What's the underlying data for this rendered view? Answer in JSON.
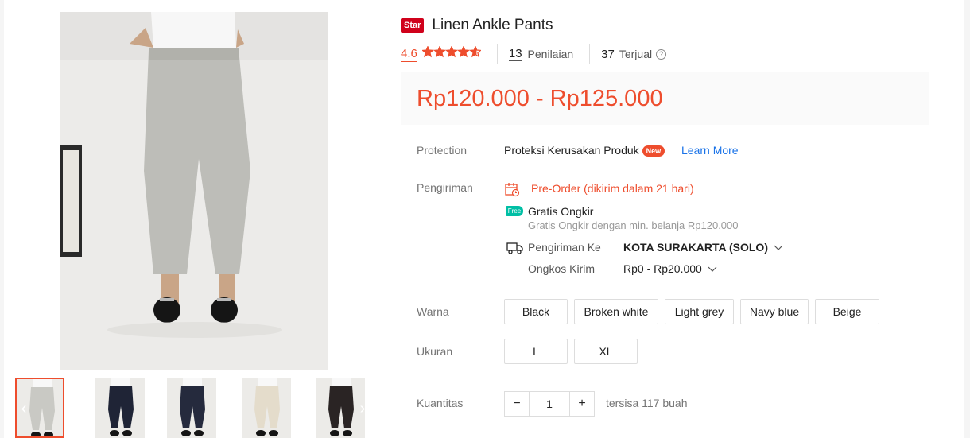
{
  "product": {
    "badge": "Star",
    "title": "Linen Ankle Pants",
    "rating": "4.6",
    "review_count": "13",
    "review_label": "Penilaian",
    "sold_count": "37",
    "sold_label": "Terjual",
    "price": "Rp120.000 - Rp125.000",
    "rating_value": 4.6
  },
  "protection": {
    "label": "Protection",
    "text": "Proteksi Kerusakan Produk",
    "new_badge": "New",
    "link": "Learn More"
  },
  "shipping": {
    "label": "Pengiriman",
    "preorder": "Pre-Order (dikirim dalam 21 hari)",
    "free_badge": "Free",
    "free_title": "Gratis Ongkir",
    "free_desc": "Gratis Ongkir dengan min. belanja Rp120.000",
    "to_label": "Pengiriman Ke",
    "to_value": "KOTA SURAKARTA (SOLO)",
    "cost_label": "Ongkos Kirim",
    "cost_value": "Rp0 - Rp20.000"
  },
  "variants": {
    "color_label": "Warna",
    "colors": [
      "Black",
      "Broken white",
      "Light grey",
      "Navy blue",
      "Beige"
    ],
    "size_label": "Ukuran",
    "sizes": [
      "L",
      "XL"
    ]
  },
  "quantity": {
    "label": "Kuantitas",
    "minus": "−",
    "value": "1",
    "plus": "+",
    "stock": "tersisa 117 buah"
  },
  "gallery": {
    "thumb_colors": [
      "#c9c9c4",
      "#1f2436",
      "#252a3d",
      "#e4dccb",
      "#2a2424"
    ],
    "prev": "‹",
    "next": "›"
  },
  "colors": {
    "accent": "#ee4d2d",
    "star_badge": "#d0011b",
    "link": "#1a73e8",
    "free": "#00bfa5"
  }
}
